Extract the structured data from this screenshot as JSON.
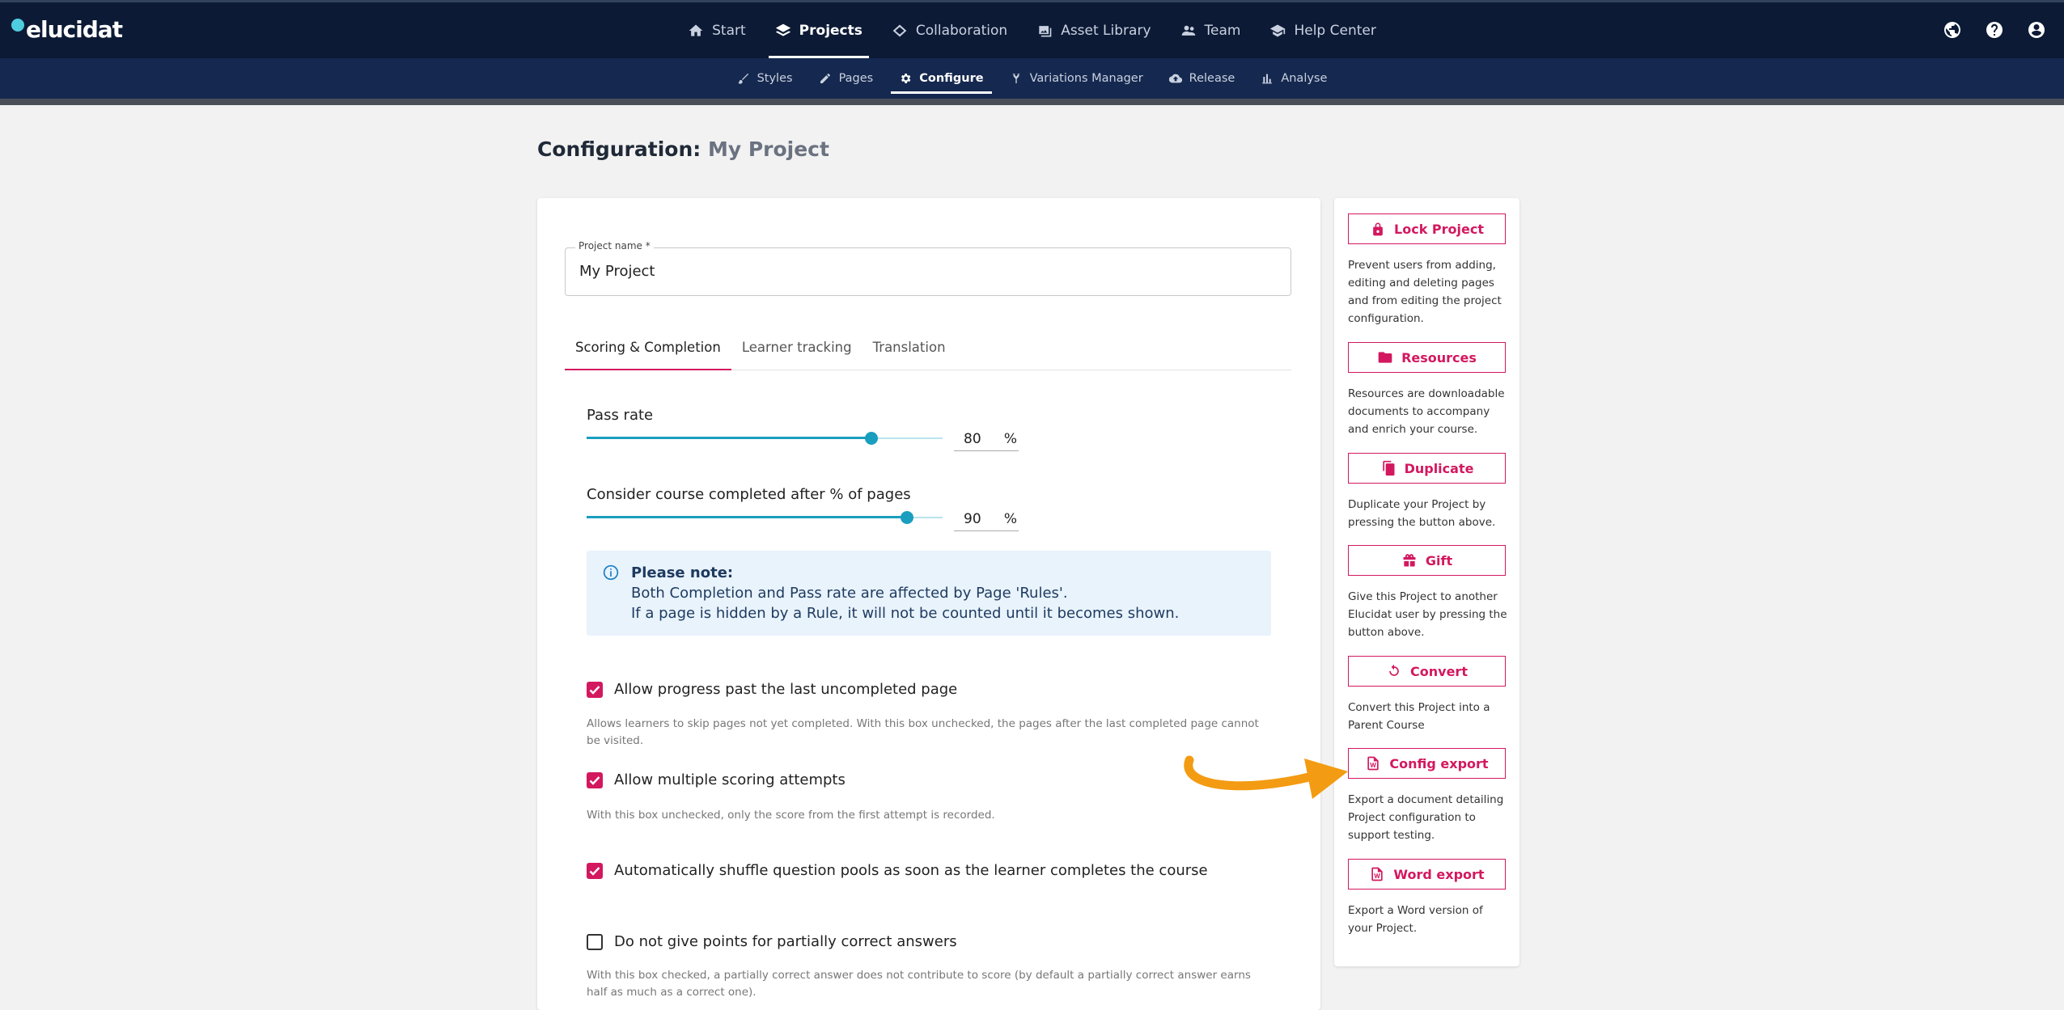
{
  "app": {
    "logo": "elucidat"
  },
  "main_nav": [
    {
      "label": "Start",
      "icon": "home-icon"
    },
    {
      "label": "Projects",
      "icon": "layers-icon",
      "active": true
    },
    {
      "label": "Collaboration",
      "icon": "collaboration-icon"
    },
    {
      "label": "Asset Library",
      "icon": "image-library-icon"
    },
    {
      "label": "Team",
      "icon": "team-icon"
    },
    {
      "label": "Help Center",
      "icon": "graduation-cap-icon"
    }
  ],
  "sub_nav": [
    {
      "label": "Styles",
      "icon": "brush-icon"
    },
    {
      "label": "Pages",
      "icon": "pencil-icon"
    },
    {
      "label": "Configure",
      "icon": "gear-icon",
      "active": true
    },
    {
      "label": "Variations Manager",
      "icon": "branch-icon"
    },
    {
      "label": "Release",
      "icon": "cloud-upload-icon"
    },
    {
      "label": "Analyse",
      "icon": "bar-chart-icon"
    }
  ],
  "page": {
    "title_prefix": "Configuration:",
    "project": "My Project"
  },
  "form": {
    "project_name_label": "Project name *",
    "project_name_value": "My Project",
    "tabs": [
      "Scoring & Completion",
      "Learner tracking",
      "Translation"
    ],
    "pass_rate": {
      "label": "Pass rate",
      "value": "80",
      "unit": "%",
      "fraction": 0.8
    },
    "completion": {
      "label": "Consider course completed after % of pages",
      "value": "90",
      "unit": "%",
      "fraction": 0.9
    },
    "note": {
      "title": "Please note:",
      "line1": "Both Completion and Pass rate are affected by Page 'Rules'.",
      "line2": "If a page is hidden by a Rule, it will not be counted until it becomes shown."
    },
    "options": [
      {
        "label": "Allow progress past the last uncompleted page",
        "checked": true,
        "help": "Allows learners to skip pages not yet completed. With this box unchecked, the pages after the last completed page cannot be visited."
      },
      {
        "label": "Allow multiple scoring attempts",
        "checked": true,
        "help": "With this box unchecked, only the score from the first attempt is recorded."
      },
      {
        "label": "Automatically shuffle question pools as soon as the learner completes the course",
        "checked": true,
        "help": ""
      },
      {
        "label": "Do not give points for partially correct answers",
        "checked": false,
        "help": "With this box checked, a partially correct answer does not contribute to score (by default a partially correct answer earns half as much as a correct one)."
      }
    ]
  },
  "actions": [
    {
      "label": "Lock Project",
      "icon": "lock-icon",
      "desc": "Prevent users from adding, editing and deleting pages and from editing the project configuration."
    },
    {
      "label": "Resources",
      "icon": "folder-icon",
      "desc": "Resources are downloadable documents to accompany and enrich your course."
    },
    {
      "label": "Duplicate",
      "icon": "copy-icon",
      "desc": "Duplicate your Project by pressing the button above."
    },
    {
      "label": "Gift",
      "icon": "gift-icon",
      "desc": "Give this Project to another Elucidat user by pressing the button above."
    },
    {
      "label": "Convert",
      "icon": "convert-icon",
      "desc": "Convert this Project into a Parent Course"
    },
    {
      "label": "Config export",
      "icon": "word-doc-icon",
      "desc": "Export a document detailing Project configuration to support testing."
    },
    {
      "label": "Word export",
      "icon": "word-doc-icon",
      "desc": "Export a Word version of your Project."
    }
  ],
  "colors": {
    "nav_bg": "#0c1a35",
    "subnav_bg": "#15284f",
    "accent": "#d3185f",
    "slider": "#1a9ebf",
    "annotation_arrow": "#f39b12"
  }
}
